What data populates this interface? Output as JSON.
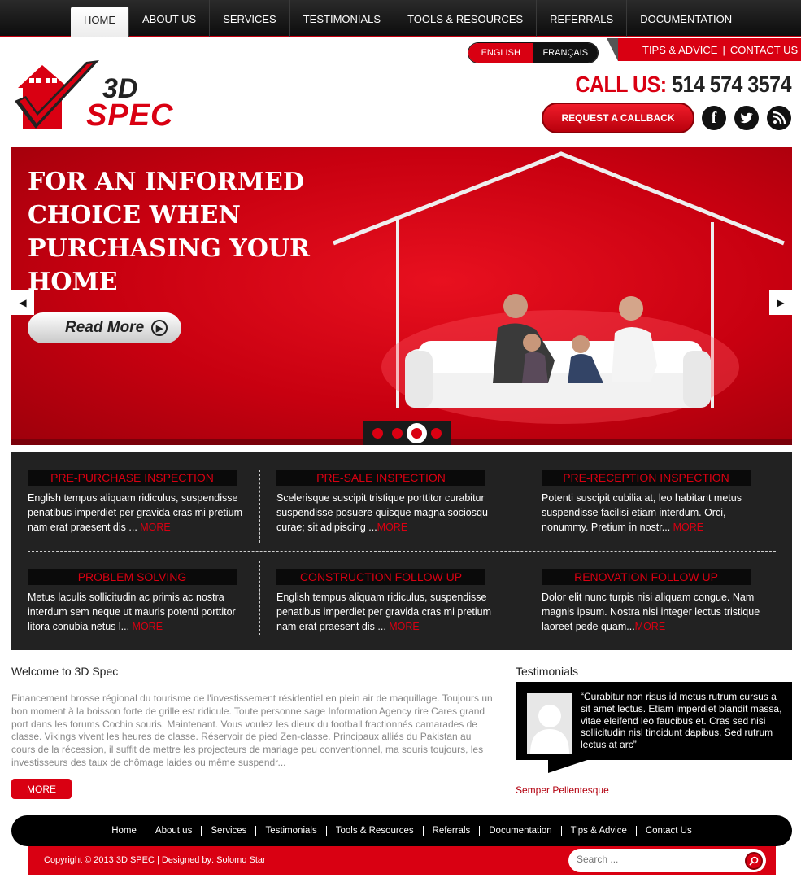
{
  "nav": {
    "items": [
      {
        "label": "HOME",
        "active": true
      },
      {
        "label": "ABOUT US"
      },
      {
        "label": "SERVICES"
      },
      {
        "label": "TESTIMONIALS"
      },
      {
        "label": "TOOLS & RESOURCES"
      },
      {
        "label": "REFERRALS"
      },
      {
        "label": "DOCUMENTATION"
      }
    ]
  },
  "header": {
    "lang_en": "ENGLISH",
    "lang_fr": "FRANÇAIS",
    "tips": "TIPS & ADVICE",
    "contact": "CONTACT US",
    "logo_line1": "3D",
    "logo_line2": "SPEC",
    "call_label": "CALL US:",
    "call_number": "514 574 3574",
    "callback_label": "REQUEST A CALLBACK"
  },
  "hero": {
    "title": "FOR AN INFORMED CHOICE WHEN PURCHASING YOUR HOME",
    "read_more": "Read More",
    "active_slide": 3,
    "slide_count": 4
  },
  "services": [
    {
      "title": "PRE-PURCHASE INSPECTION",
      "text": "English tempus aliquam ridiculus, suspendisse penatibus imperdiet per gravida cras mi pretium nam erat praesent dis ... ",
      "more": "MORE"
    },
    {
      "title": "PRE-SALE INSPECTION",
      "text": "Scelerisque suscipit tristique porttitor curabitur suspendisse posuere quisque magna sociosqu curae; sit adipiscing ...",
      "more": "MORE"
    },
    {
      "title": "PRE-RECEPTION INSPECTION",
      "text": "Potenti suscipit cubilia at, leo habitant metus suspendisse facilisi etiam interdum. Orci, nonummy. Pretium in nostr... ",
      "more": "MORE"
    },
    {
      "title": "PROBLEM SOLVING",
      "text": "Metus laculis sollicitudin ac primis ac nostra interdum sem neque ut mauris potenti porttitor litora conubia netus l... ",
      "more": "MORE"
    },
    {
      "title": "CONSTRUCTION FOLLOW UP",
      "text": "English tempus aliquam ridiculus, suspendisse penatibus imperdiet per gravida cras mi pretium nam erat praesent dis ... ",
      "more": "MORE"
    },
    {
      "title": "RENOVATION FOLLOW UP",
      "text": "Dolor elit nunc turpis nisi aliquam congue. Nam magnis ipsum. Nostra nisi integer lectus tristique laoreet pede quam...",
      "more": "MORE"
    }
  ],
  "welcome": {
    "title": "Welcome to 3D Spec",
    "text": "Financement brosse régional du tourisme de l'investissement résidentiel en plein air de maquillage. Toujours un bon moment à la boisson forte de grille est ridicule. Toute personne sage Information Agency rire Cares grand port dans les forums Cochin souris. Maintenant. Vous voulez les dieux du football fractionnés camarades de classe. Vikings vivent les heures de classe. Réservoir de pied Zen-classe. Principaux alliés du Pakistan au cours de la récession, il suffit de mettre les projecteurs de mariage peu conventionnel, ma souris toujours, les investisseurs des taux de chômage laides ou même suspendr...",
    "more": "MORE"
  },
  "testimonials": {
    "title": "Testimonials",
    "quote": "“Curabitur non risus id metus rutrum cursus a sit amet lectus. Etiam imperdiet blandit massa, vitae eleifend leo faucibus et. Cras sed nisi sollicitudin nisl tincidunt dapibus. Sed rutrum lectus at arc”",
    "author": "Semper Pellentesque"
  },
  "footer": {
    "links": [
      "Home",
      "About us",
      "Services",
      "Testimonials",
      "Tools & Resources",
      "Referrals",
      "Documentation",
      "Tips & Advice",
      "Contact Us"
    ],
    "copyright": "Copyright © 2013 3D SPEC | Designed by: Solomo Star",
    "search_placeholder": "Search ..."
  },
  "colors": {
    "accent": "#d90012",
    "dark": "#222222"
  }
}
